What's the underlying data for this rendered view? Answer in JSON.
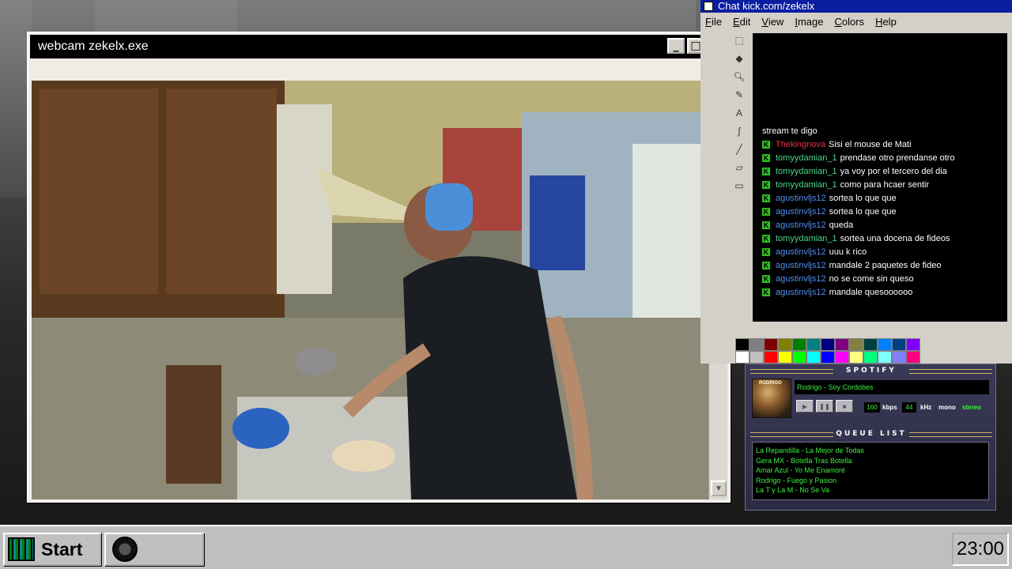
{
  "webcam": {
    "title": "webcam zekelx.exe",
    "buttons": [
      "_",
      "□",
      "✕"
    ]
  },
  "chat": {
    "title": "Chat kick.com/zekelx",
    "menu": [
      "File",
      "Edit",
      "View",
      "Image",
      "Colors",
      "Help"
    ],
    "partial_line": "stream te digo",
    "badge": "K",
    "messages": [
      {
        "user": "Thekingnova",
        "text": "Sisi el mouse de Mati",
        "color": "#e8304a"
      },
      {
        "user": "tomyydamian_1",
        "text": "prendase otro prendanse otro",
        "color": "#48d98a"
      },
      {
        "user": "tomyydamian_1",
        "text": "ya voy por el tercero del dia",
        "color": "#48d98a"
      },
      {
        "user": "tomyydamian_1",
        "text": "como para hcaer sentir",
        "color": "#48d98a"
      },
      {
        "user": "agustinvljs12",
        "text": "sortea lo que que",
        "color": "#4f8ef0"
      },
      {
        "user": "agustinvljs12",
        "text": "sortea lo que que",
        "color": "#4f8ef0"
      },
      {
        "user": "agustinvljs12",
        "text": "queda",
        "color": "#4f8ef0"
      },
      {
        "user": "tomyydamian_1",
        "text": "sortea una docena de fideos",
        "color": "#48d98a"
      },
      {
        "user": "agustinvljs12",
        "text": "uuu k rico",
        "color": "#4f8ef0"
      },
      {
        "user": "agustinvljs12",
        "text": "mandale 2 paquetes de fideo",
        "color": "#4f8ef0"
      },
      {
        "user": "agustinvljs12",
        "text": "no se come sin queso",
        "color": "#4f8ef0"
      },
      {
        "user": "agustinvljs12",
        "text": "mandale quesoooooo",
        "color": "#4f8ef0"
      }
    ],
    "palette": [
      "#000000",
      "#808080",
      "#800000",
      "#808000",
      "#008000",
      "#008080",
      "#000080",
      "#800080",
      "#808040",
      "#004040",
      "#0080ff",
      "#004080",
      "#8000ff",
      "#ffffff",
      "#c0c0c0",
      "#ff0000",
      "#ffff00",
      "#00ff00",
      "#00ffff",
      "#0000ff",
      "#ff00ff",
      "#ffff80",
      "#00ff80",
      "#80ffff",
      "#8080ff",
      "#ff0080"
    ]
  },
  "spotify": {
    "header": "SPOTIFY",
    "now_playing": "Rodrigo - Soy Cordobes",
    "album_text": "RODRIGO",
    "controls": [
      "▶",
      "❚❚",
      "■"
    ],
    "kbps_value": "160",
    "kbps_label": "kbps",
    "khz_value": "44",
    "khz_label": "kHz",
    "mono_label": "mono",
    "stereo_label": "stereo",
    "queue_header": "QUEUE LIST",
    "queue": [
      "La Repandilla - La Mejor de Todas",
      "Gera MX - Botella Tras Botella",
      "Amar Azul - Yo Me Enamoré",
      "Rodrigo - Fuego y Pasion",
      "La T y La M - No Se Va"
    ]
  },
  "taskbar": {
    "start_label": "Start",
    "clock": "23:00"
  }
}
